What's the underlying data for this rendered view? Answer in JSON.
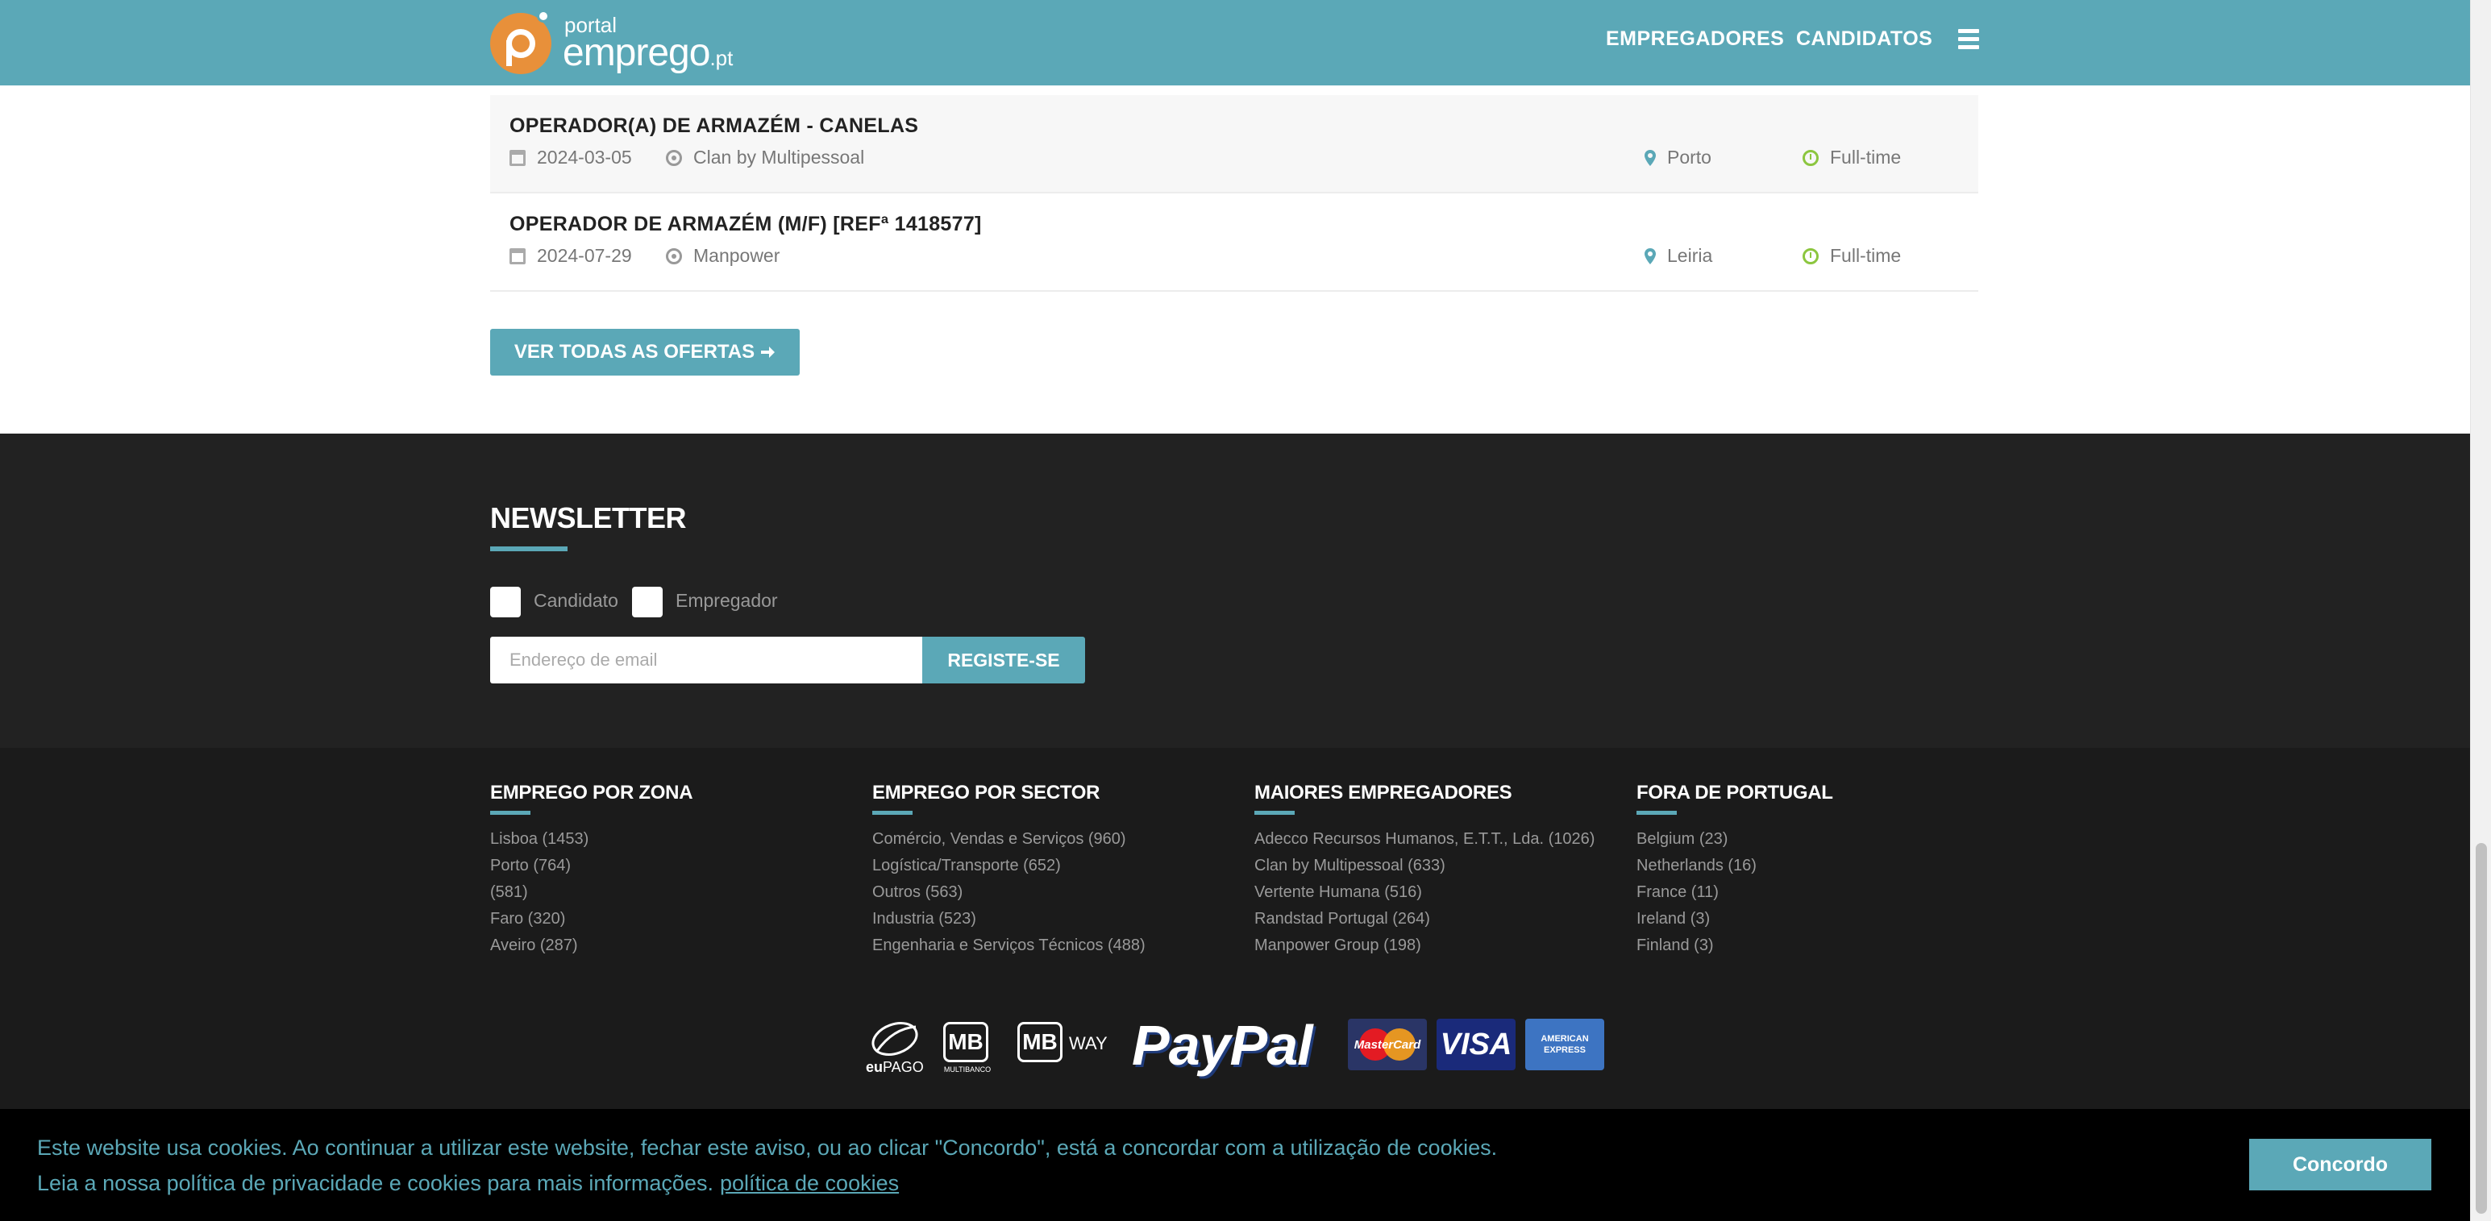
{
  "header": {
    "logo_small": "portal",
    "logo_big": "emprego",
    "logo_tld": ".pt",
    "nav_employers": "EMPREGADORES",
    "nav_candidates": "CANDIDATOS"
  },
  "jobs": [
    {
      "title": "OPERADOR(A) DE ARMAZÉM - CANELAS",
      "date": "2024-03-05",
      "company": "Clan by Multipessoal",
      "location": "Porto",
      "type": "Full-time"
    },
    {
      "title": "OPERADOR DE ARMAZÉM (M/F) [REFª 1418577]",
      "date": "2024-07-29",
      "company": "Manpower",
      "location": "Leiria",
      "type": "Full-time"
    }
  ],
  "see_all_label": "VER TODAS AS OFERTAS",
  "newsletter": {
    "title": "NEWSLETTER",
    "option_candidate": "Candidato",
    "option_employer": "Empregador",
    "email_placeholder": "Endereço de email",
    "register_label": "REGISTE-SE"
  },
  "footer": {
    "columns": [
      {
        "title": "EMPREGO POR ZONA",
        "items": [
          "Lisboa (1453)",
          "Porto (764)",
          "(581)",
          "Faro (320)",
          "Aveiro (287)"
        ]
      },
      {
        "title": "EMPREGO POR SECTOR",
        "items": [
          "Comércio, Vendas e Serviços (960)",
          "Logística/Transporte (652)",
          "Outros (563)",
          "Industria (523)",
          "Engenharia e Serviços Técnicos (488)"
        ]
      },
      {
        "title": "MAIORES EMPREGADORES",
        "items": [
          "Adecco Recursos Humanos, E.T.T., Lda. (1026)",
          "Clan by Multipessoal (633)",
          "Vertente Humana (516)",
          "Randstad Portugal (264)",
          "Manpower Group (198)"
        ]
      },
      {
        "title": "FORA DE PORTUGAL",
        "items": [
          "Belgium (23)",
          "Netherlands (16)",
          "France (11)",
          "Ireland (3)",
          "Finland (3)"
        ]
      }
    ]
  },
  "payments": {
    "eupago_eu": "eu",
    "eupago_pago": "PAGO",
    "mb": "MB",
    "multibanco": "MULTIBANCO",
    "mbway_mb": "MB",
    "mbway_way": "WAY",
    "paypal": "PayPal",
    "mastercard": "MasterCard",
    "visa": "VISA",
    "amex": "AMERICAN EXPRESS"
  },
  "cookie": {
    "line1": "Este website usa cookies. Ao continuar a utilizar este website, fechar este aviso, ou ao clicar \"Concordo\", está a concordar com a utilização de cookies.",
    "line2": "Leia a nossa política de privacidade e cookies para mais informações.",
    "link": "política de cookies",
    "accept": "Concordo"
  },
  "colors": {
    "accent": "#5ba8b7",
    "logo_orange": "#e8903a",
    "newsletter_bg": "#222222",
    "footer_bg": "#1b1b1b",
    "cookie_bg": "#000000",
    "fulltime_green": "#8cc63f"
  }
}
